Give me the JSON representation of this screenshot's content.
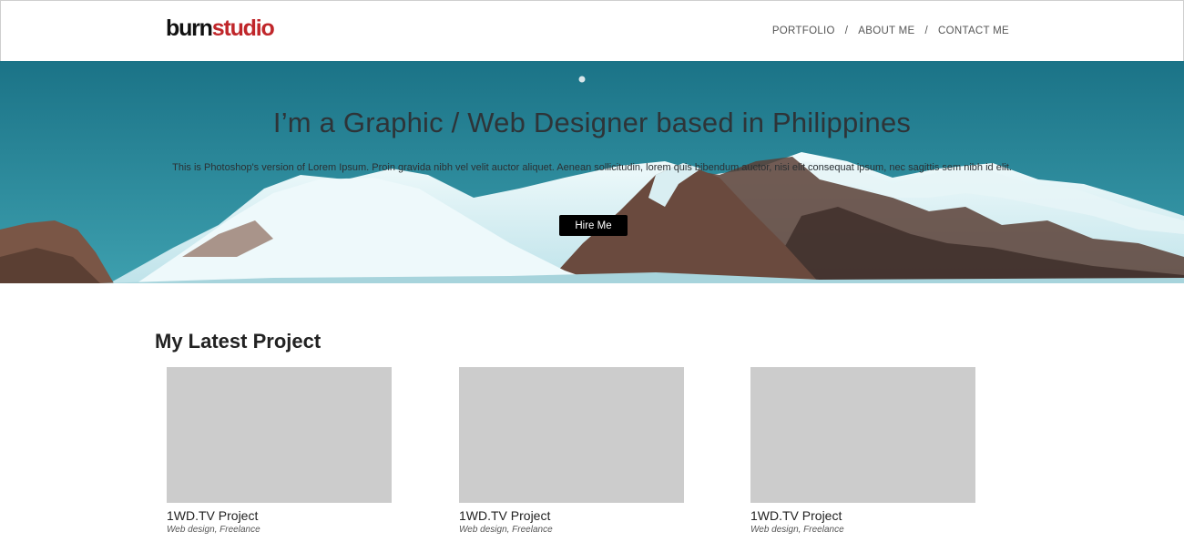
{
  "header": {
    "logo_part1": "burn",
    "logo_part2": "studio",
    "nav": [
      {
        "label": "PORTFOLIO"
      },
      {
        "label": "ABOUT ME"
      },
      {
        "label": "CONTACT ME"
      }
    ],
    "separator": "/"
  },
  "hero": {
    "title": "I’m a Graphic / Web Designer based in Philippines",
    "text": "This is Photoshop's version of Lorem Ipsum. Proin gravida nibh vel velit auctor aliquet. Aenean sollicitudin, lorem quis bibendum auctor, nisi elit consequat ipsum, nec sagittis sem nibh id elit.",
    "button": "Hire Me"
  },
  "projects": {
    "heading": "My Latest Project",
    "items": [
      {
        "title": "1WD.TV Project",
        "meta": "Web design, Freelance"
      },
      {
        "title": "1WD.TV Project",
        "meta": "Web design, Freelance"
      },
      {
        "title": "1WD.TV Project",
        "meta": "Web design, Freelance"
      }
    ]
  },
  "colors": {
    "brand_red": "#c0262a",
    "hero_sky": "#2a8da0",
    "button": "#000000",
    "placeholder": "#cccccc"
  }
}
